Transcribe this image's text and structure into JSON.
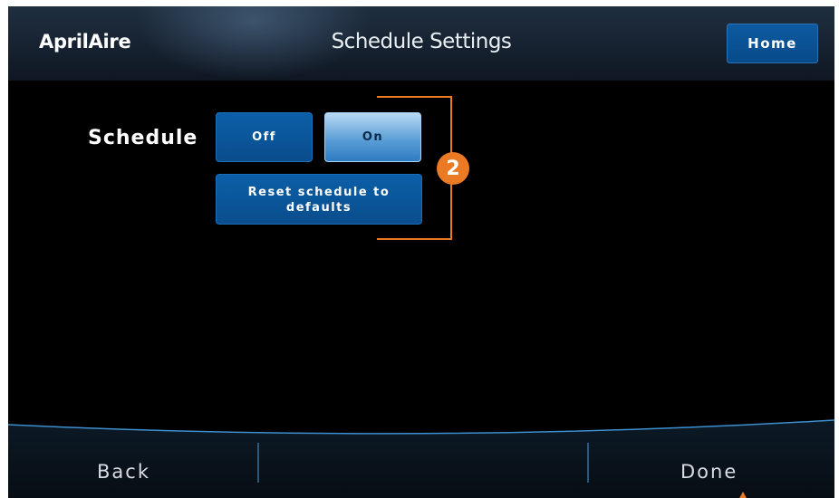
{
  "header": {
    "logo_text": "AprilAire",
    "title": "Schedule Settings",
    "home_label": "Home"
  },
  "schedule": {
    "label": "Schedule",
    "off_label": "Off",
    "on_label": "On",
    "selected": "On",
    "reset_label": "Reset schedule to defaults"
  },
  "annotation": {
    "badge_number": "2"
  },
  "footer": {
    "back_label": "Back",
    "done_label": "Done"
  },
  "colors": {
    "accent_orange": "#EA7A23",
    "button_blue": "#0A4D8C",
    "selected_blue": "#5B9ED6",
    "header_bg": "#182433"
  }
}
